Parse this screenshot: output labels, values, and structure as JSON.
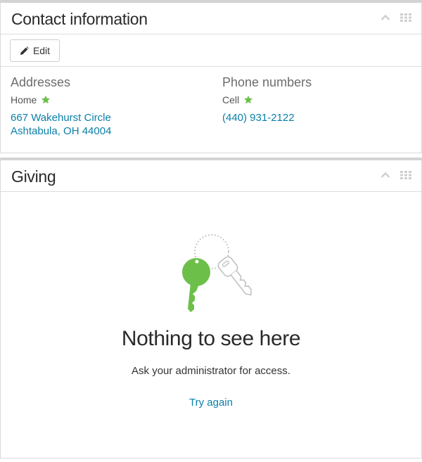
{
  "contact": {
    "title": "Contact information",
    "edit_label": "Edit",
    "addresses": {
      "heading": "Addresses",
      "type": "Home",
      "line1": "667 Wakehurst Circle",
      "line2": "Ashtabula, OH 44004"
    },
    "phones": {
      "heading": "Phone numbers",
      "type": "Cell",
      "number": "(440) 931-2122"
    }
  },
  "giving": {
    "title": "Giving",
    "empty_title": "Nothing to see here",
    "empty_message": "Ask your administrator for access.",
    "retry_label": "Try again"
  },
  "icons": {
    "collapse": "chevron-up-icon",
    "drag": "grip-icon",
    "edit": "pencil-icon",
    "primary": "star-icon",
    "illustration": "keys-icon"
  },
  "colors": {
    "link": "#0b7fa8",
    "star": "#6cc04a",
    "key": "#6cc04a"
  }
}
